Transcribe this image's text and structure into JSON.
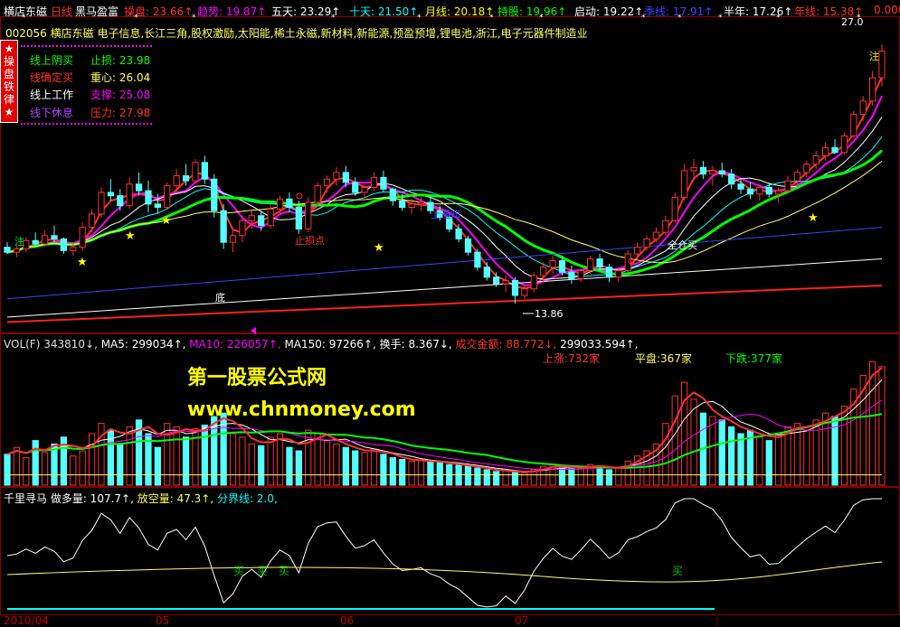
{
  "topbar": {
    "items": [
      {
        "label": "横店东磁",
        "value": "",
        "color": "#ffffff"
      },
      {
        "label": "日线",
        "value": "",
        "color": "#ff3030"
      },
      {
        "label": "黑马盈富",
        "value": "",
        "color": "#ffffff"
      },
      {
        "label": "操盘:",
        "value": "23.66↑",
        "color": "#ff3030"
      },
      {
        "label": "趋势:",
        "value": "19.87↑",
        "color": "#ff00ff"
      },
      {
        "label": "五天:",
        "value": "23.29↑",
        "color": "#ffffff"
      },
      {
        "label": "十天:",
        "value": "21.50↑",
        "color": "#00ffff"
      },
      {
        "label": "月线:",
        "value": "20.18↑",
        "color": "#ffff00"
      },
      {
        "label": "持股:",
        "value": "19.96↑",
        "color": "#00ff00"
      },
      {
        "label": "启动:",
        "value": "19.22↑",
        "color": "#ffffff"
      },
      {
        "label": "季线:",
        "value": "17.91↑",
        "color": "#4040ff"
      },
      {
        "label": "半年:",
        "value": "17.26↑",
        "color": "#ffffff"
      },
      {
        "label": "年线:",
        "value": "15.38↑",
        "color": "#ff3030"
      },
      {
        "label": "",
        "value": "0.000",
        "color": "#ff3030"
      }
    ]
  },
  "stock_line": "002056  横店东磁  电子信息,长江三角,股权激励,太阳能,稀土永磁,新材料,新能源,预盈预增,锂电池,浙江,电子元器件制造业",
  "badge": {
    "chars": [
      "★",
      "操",
      "盘",
      "铁",
      "律",
      "★"
    ]
  },
  "legend": {
    "rows": [
      {
        "left": "线上阴买",
        "left_color": "#00ff00",
        "right": "止损: 23.98",
        "right_color": "#00ff00"
      },
      {
        "left": "线确定买",
        "left_color": "#ff3030",
        "right": "重心: 26.04",
        "right_color": "#ffff66"
      },
      {
        "left": "线上工作",
        "left_color": "#ffffff",
        "right": "支撑: 25.08",
        "right_color": "#ff00ff"
      },
      {
        "left": "线下休息",
        "left_color": "#b040ff",
        "right": "压力: 27.98",
        "right_color": "#ff3030"
      }
    ]
  },
  "main_annotations": {
    "top_right_price": "27.0",
    "high_label": "注",
    "low_price": "13.86",
    "bottom_label": "底",
    "stop_label": "止损点",
    "trend_label": "上通知",
    "full_buy": "全仓买",
    "left_label": "注"
  },
  "volume": {
    "title": "VOL(F) 343810↓, MA5: 299034↑, MA10: 226057↑, MA150: 97266↑, 换手: 8.367↓, 成交金额: 88.772↓, 299033.594↑,",
    "parts": [
      {
        "text": "VOL(F) 343810↓,",
        "color": "#dddddd"
      },
      {
        "text": "MA5: 299034↑,",
        "color": "#ffffff"
      },
      {
        "text": "MA10: 226057↑,",
        "color": "#ff00ff"
      },
      {
        "text": "MA150: 97266↑,",
        "color": "#ffffff"
      },
      {
        "text": "换手: 8.367↓,",
        "color": "#ffffff"
      },
      {
        "text": "成交金额: 88.772↓,",
        "color": "#ff3030"
      },
      {
        "text": "299033.594↑,",
        "color": "#ffffff"
      }
    ],
    "up_label": "上涨:732家",
    "flat_label": "平盘:367家",
    "down_label": "下跌:377家"
  },
  "indicator": {
    "parts": [
      {
        "text": "千里寻马",
        "color": "#ffffff"
      },
      {
        "text": "做多量: 107.7↑,",
        "color": "#ffffff"
      },
      {
        "text": "放空量: 47.3↑,",
        "color": "#ffff66"
      },
      {
        "text": "分界线: 2.0,",
        "color": "#00ffff"
      }
    ],
    "buy_marks": [
      "买",
      "买",
      "买",
      "买"
    ]
  },
  "watermark": {
    "line1": "第一股票公式网",
    "line2": "www.chnmoney.com"
  },
  "dates": [
    "2010/04",
    "05",
    "06",
    "07"
  ],
  "colors": {
    "up": "#ff3030",
    "down": "#54ffff",
    "frame": "#8b0000",
    "background": "#000000"
  },
  "chart_data": {
    "type": "candlestick",
    "candles": [
      [
        17.3,
        17.6,
        16.9,
        17.0
      ],
      [
        17.0,
        17.4,
        16.7,
        17.2
      ],
      [
        17.2,
        17.9,
        17.0,
        17.7
      ],
      [
        17.7,
        18.2,
        17.3,
        17.5
      ],
      [
        17.5,
        18.3,
        17.3,
        18.0
      ],
      [
        18.0,
        18.6,
        17.6,
        17.8
      ],
      [
        17.8,
        17.9,
        16.9,
        17.1
      ],
      [
        17.1,
        17.5,
        16.8,
        17.3
      ],
      [
        17.3,
        18.8,
        17.1,
        18.5
      ],
      [
        18.5,
        19.6,
        18.2,
        19.3
      ],
      [
        19.3,
        20.9,
        19.1,
        20.6
      ],
      [
        20.6,
        21.4,
        20.1,
        20.4
      ],
      [
        20.4,
        20.8,
        19.5,
        19.8
      ],
      [
        19.8,
        21.5,
        19.6,
        21.1
      ],
      [
        21.1,
        21.8,
        20.4,
        20.7
      ],
      [
        20.7,
        21.3,
        19.4,
        19.9
      ],
      [
        19.9,
        20.5,
        19.3,
        19.7
      ],
      [
        19.7,
        21.2,
        19.6,
        21.0
      ],
      [
        21.0,
        22.0,
        20.6,
        21.6
      ],
      [
        21.6,
        22.3,
        21.0,
        21.3
      ],
      [
        21.3,
        22.6,
        21.1,
        22.4
      ],
      [
        22.4,
        22.8,
        21.1,
        21.4
      ],
      [
        21.4,
        21.7,
        19.1,
        19.5
      ],
      [
        19.5,
        19.9,
        17.2,
        17.6
      ],
      [
        17.6,
        18.4,
        17.0,
        18.0
      ],
      [
        18.0,
        19.2,
        17.6,
        18.9
      ],
      [
        18.9,
        19.6,
        18.4,
        19.2
      ],
      [
        19.2,
        19.5,
        18.3,
        18.6
      ],
      [
        18.6,
        19.9,
        18.4,
        19.6
      ],
      [
        19.6,
        20.4,
        19.3,
        20.2
      ],
      [
        20.2,
        20.6,
        19.4,
        19.7
      ],
      [
        19.7,
        20.1,
        18.1,
        18.4
      ],
      [
        18.4,
        20.3,
        18.2,
        20.0
      ],
      [
        20.0,
        21.2,
        19.8,
        21.0
      ],
      [
        21.0,
        21.6,
        20.6,
        21.4
      ],
      [
        21.4,
        22.1,
        21.0,
        21.8
      ],
      [
        21.8,
        22.2,
        20.9,
        21.2
      ],
      [
        21.2,
        21.5,
        20.4,
        20.6
      ],
      [
        20.6,
        21.1,
        20.1,
        20.9
      ],
      [
        20.9,
        21.8,
        20.7,
        21.5
      ],
      [
        21.5,
        21.9,
        20.6,
        20.8
      ],
      [
        20.8,
        20.9,
        19.8,
        20.1
      ],
      [
        20.1,
        20.5,
        19.5,
        19.7
      ],
      [
        19.7,
        20.2,
        19.3,
        19.9
      ],
      [
        19.9,
        20.3,
        19.5,
        20.0
      ],
      [
        20.0,
        20.4,
        19.3,
        19.5
      ],
      [
        19.5,
        19.8,
        18.9,
        19.1
      ],
      [
        19.1,
        19.4,
        18.2,
        18.4
      ],
      [
        18.4,
        18.7,
        17.6,
        17.8
      ],
      [
        17.8,
        18.0,
        16.8,
        17.0
      ],
      [
        17.0,
        17.2,
        15.9,
        16.1
      ],
      [
        16.1,
        16.4,
        15.3,
        15.5
      ],
      [
        15.5,
        15.8,
        14.9,
        15.1
      ],
      [
        15.1,
        15.6,
        14.6,
        15.3
      ],
      [
        15.3,
        15.5,
        13.9,
        14.4
      ],
      [
        14.4,
        15.0,
        14.2,
        14.8
      ],
      [
        14.8,
        15.8,
        14.6,
        15.6
      ],
      [
        15.6,
        16.4,
        15.2,
        16.1
      ],
      [
        16.1,
        16.8,
        15.7,
        16.5
      ],
      [
        16.5,
        16.8,
        15.6,
        15.8
      ],
      [
        15.8,
        16.2,
        15.1,
        15.4
      ],
      [
        15.4,
        16.0,
        15.2,
        15.9
      ],
      [
        15.9,
        16.8,
        15.7,
        16.6
      ],
      [
        16.6,
        16.9,
        15.9,
        16.1
      ],
      [
        16.1,
        16.3,
        15.2,
        15.5
      ],
      [
        15.5,
        16.1,
        15.2,
        15.9
      ],
      [
        15.9,
        17.1,
        15.8,
        16.9
      ],
      [
        16.9,
        17.6,
        16.5,
        17.3
      ],
      [
        17.3,
        18.0,
        17.1,
        17.8
      ],
      [
        17.8,
        18.5,
        17.6,
        18.2
      ],
      [
        18.2,
        19.2,
        18.0,
        18.9
      ],
      [
        18.9,
        20.6,
        18.8,
        20.3
      ],
      [
        20.3,
        22.3,
        20.1,
        21.9
      ],
      [
        21.9,
        22.6,
        21.3,
        22.1
      ],
      [
        22.1,
        22.5,
        21.4,
        21.7
      ],
      [
        21.7,
        22.2,
        21.0,
        21.9
      ],
      [
        21.9,
        22.4,
        21.5,
        21.7
      ],
      [
        21.7,
        22.0,
        20.8,
        21.1
      ],
      [
        21.1,
        21.4,
        20.5,
        20.8
      ],
      [
        20.8,
        21.2,
        20.2,
        20.5
      ],
      [
        20.5,
        21.0,
        20.1,
        20.9
      ],
      [
        20.9,
        21.2,
        20.3,
        20.5
      ],
      [
        20.5,
        20.9,
        20.0,
        20.7
      ],
      [
        20.7,
        21.6,
        20.5,
        21.3
      ],
      [
        21.3,
        22.0,
        21.1,
        21.8
      ],
      [
        21.8,
        22.5,
        21.5,
        22.3
      ],
      [
        22.3,
        23.1,
        22.0,
        22.8
      ],
      [
        22.8,
        23.6,
        22.5,
        23.3
      ],
      [
        23.3,
        23.8,
        22.9,
        23.0
      ],
      [
        23.0,
        24.2,
        22.9,
        24.0
      ],
      [
        24.0,
        25.5,
        23.9,
        25.3
      ],
      [
        25.3,
        26.4,
        24.9,
        26.1
      ],
      [
        26.1,
        27.9,
        25.8,
        27.5
      ],
      [
        27.5,
        29.5,
        27.0,
        29.1
      ]
    ],
    "volume": [
      90,
      110,
      80,
      130,
      95,
      120,
      140,
      85,
      100,
      150,
      180,
      160,
      120,
      170,
      190,
      150,
      110,
      180,
      170,
      140,
      165,
      175,
      200,
      210,
      150,
      140,
      120,
      115,
      140,
      150,
      110,
      100,
      160,
      150,
      130,
      120,
      110,
      100,
      95,
      105,
      90,
      80,
      75,
      70,
      72,
      68,
      66,
      60,
      58,
      55,
      50,
      45,
      40,
      42,
      38,
      36,
      45,
      55,
      60,
      50,
      48,
      52,
      60,
      55,
      45,
      50,
      70,
      85,
      100,
      120,
      180,
      260,
      300,
      250,
      210,
      200,
      190,
      170,
      150,
      160,
      140,
      130,
      150,
      170,
      180,
      160,
      190,
      210,
      200,
      230,
      280,
      320,
      360,
      345
    ],
    "ylim": [
      12.5,
      30
    ]
  }
}
